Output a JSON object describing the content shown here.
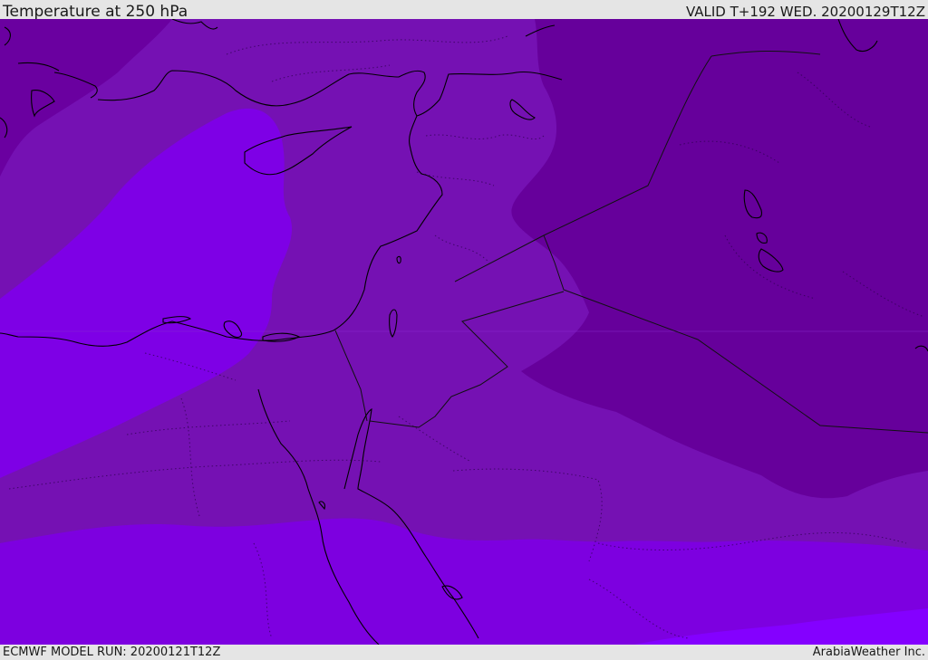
{
  "header": {
    "title": "Temperature at 250 hPa",
    "valid_time": "VALID T+192 WED. 20200129T12Z"
  },
  "footer": {
    "model_run": "ECMWF MODEL RUN: 20200121T12Z",
    "credit": "ArabiaWeather Inc."
  },
  "map": {
    "colors": {
      "coldest": "#6a0099",
      "cold": "#7510b0",
      "mid": "#7d00e0",
      "warm": "#7f00f2",
      "warmest": "#8800ff",
      "coastline": "#000000",
      "border": "#1a1a1a"
    }
  }
}
